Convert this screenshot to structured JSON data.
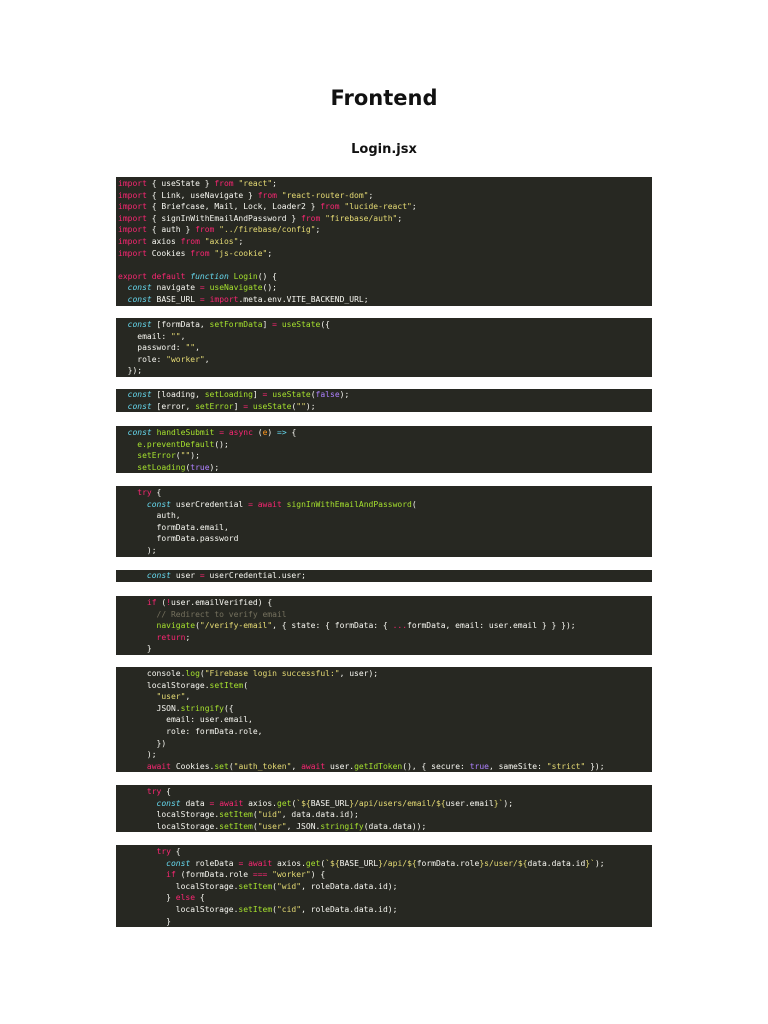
{
  "document": {
    "title": "Frontend",
    "subtitle": "Login.jsx"
  },
  "syntax_colors": {
    "background": "#272822",
    "text": "#f8f8f2",
    "keyword": "#f92672",
    "string": "#e6db74",
    "function": "#a6e22e",
    "storage": "#66d9ef",
    "number_boolean": "#ae81ff",
    "comment": "#75715e",
    "parameter": "#fd971f"
  },
  "code_blocks": [
    {
      "lines": [
        [
          [
            "k",
            "import"
          ],
          [
            "t",
            " { useState } "
          ],
          [
            "k",
            "from"
          ],
          [
            "t",
            " "
          ],
          [
            "s",
            "\"react\""
          ],
          [
            "t",
            ";"
          ]
        ],
        [
          [
            "k",
            "import"
          ],
          [
            "t",
            " { Link, useNavigate } "
          ],
          [
            "k",
            "from"
          ],
          [
            "t",
            " "
          ],
          [
            "s",
            "\"react-router-dom\""
          ],
          [
            "t",
            ";"
          ]
        ],
        [
          [
            "k",
            "import"
          ],
          [
            "t",
            " { Briefcase, Mail, Lock, Loader2 } "
          ],
          [
            "k",
            "from"
          ],
          [
            "t",
            " "
          ],
          [
            "s",
            "\"lucide-react\""
          ],
          [
            "t",
            ";"
          ]
        ],
        [
          [
            "k",
            "import"
          ],
          [
            "t",
            " { signInWithEmailAndPassword } "
          ],
          [
            "k",
            "from"
          ],
          [
            "t",
            " "
          ],
          [
            "s",
            "\"firebase/auth\""
          ],
          [
            "t",
            ";"
          ]
        ],
        [
          [
            "k",
            "import"
          ],
          [
            "t",
            " { auth } "
          ],
          [
            "k",
            "from"
          ],
          [
            "t",
            " "
          ],
          [
            "s",
            "\"../firebase/config\""
          ],
          [
            "t",
            ";"
          ]
        ],
        [
          [
            "k",
            "import"
          ],
          [
            "t",
            " axios "
          ],
          [
            "k",
            "from"
          ],
          [
            "t",
            " "
          ],
          [
            "s",
            "\"axios\""
          ],
          [
            "t",
            ";"
          ]
        ],
        [
          [
            "k",
            "import"
          ],
          [
            "t",
            " Cookies "
          ],
          [
            "k",
            "from"
          ],
          [
            "t",
            " "
          ],
          [
            "s",
            "\"js-cookie\""
          ],
          [
            "t",
            ";"
          ]
        ],
        [
          [
            "t",
            ""
          ]
        ],
        [
          [
            "k",
            "export"
          ],
          [
            "t",
            " "
          ],
          [
            "k",
            "default"
          ],
          [
            "t",
            " "
          ],
          [
            "b",
            "function"
          ],
          [
            "t",
            " "
          ],
          [
            "f",
            "Login"
          ],
          [
            "t",
            "() {"
          ]
        ],
        [
          [
            "t",
            "  "
          ],
          [
            "b",
            "const"
          ],
          [
            "t",
            " navigate "
          ],
          [
            "o",
            "="
          ],
          [
            "t",
            " "
          ],
          [
            "f",
            "useNavigate"
          ],
          [
            "t",
            "();"
          ]
        ],
        [
          [
            "t",
            "  "
          ],
          [
            "b",
            "const"
          ],
          [
            "t",
            " BASE_URL "
          ],
          [
            "o",
            "="
          ],
          [
            "t",
            " "
          ],
          [
            "k",
            "import"
          ],
          [
            "t",
            ".meta.env.VITE_BACKEND_URL;"
          ]
        ]
      ]
    },
    {
      "lines": [
        [
          [
            "t",
            "  "
          ],
          [
            "b",
            "const"
          ],
          [
            "t",
            " [formData, "
          ],
          [
            "f",
            "setFormData"
          ],
          [
            "t",
            "] "
          ],
          [
            "o",
            "="
          ],
          [
            "t",
            " "
          ],
          [
            "f",
            "useState"
          ],
          [
            "t",
            "({"
          ]
        ],
        [
          [
            "t",
            "    email: "
          ],
          [
            "s",
            "\"\""
          ],
          [
            "t",
            ","
          ]
        ],
        [
          [
            "t",
            "    password: "
          ],
          [
            "s",
            "\"\""
          ],
          [
            "t",
            ","
          ]
        ],
        [
          [
            "t",
            "    role: "
          ],
          [
            "s",
            "\"worker\""
          ],
          [
            "t",
            ","
          ]
        ],
        [
          [
            "t",
            "  });"
          ]
        ]
      ]
    },
    {
      "lines": [
        [
          [
            "t",
            "  "
          ],
          [
            "b",
            "const"
          ],
          [
            "t",
            " [loading, "
          ],
          [
            "f",
            "setLoading"
          ],
          [
            "t",
            "] "
          ],
          [
            "o",
            "="
          ],
          [
            "t",
            " "
          ],
          [
            "f",
            "useState"
          ],
          [
            "t",
            "("
          ],
          [
            "n",
            "false"
          ],
          [
            "t",
            ");"
          ]
        ],
        [
          [
            "t",
            "  "
          ],
          [
            "b",
            "const"
          ],
          [
            "t",
            " [error, "
          ],
          [
            "f",
            "setError"
          ],
          [
            "t",
            "] "
          ],
          [
            "o",
            "="
          ],
          [
            "t",
            " "
          ],
          [
            "f",
            "useState"
          ],
          [
            "t",
            "("
          ],
          [
            "s",
            "\"\""
          ],
          [
            "t",
            ");"
          ]
        ]
      ]
    },
    {
      "lines": [
        [
          [
            "t",
            "  "
          ],
          [
            "b",
            "const"
          ],
          [
            "t",
            " "
          ],
          [
            "f",
            "handleSubmit"
          ],
          [
            "t",
            " "
          ],
          [
            "o",
            "="
          ],
          [
            "t",
            " "
          ],
          [
            "k",
            "async"
          ],
          [
            "t",
            " ("
          ],
          [
            "p",
            "e"
          ],
          [
            "t",
            ") "
          ],
          [
            "b",
            "=>"
          ],
          [
            "t",
            " {"
          ]
        ],
        [
          [
            "t",
            "    "
          ],
          [
            "f",
            "e.preventDefault"
          ],
          [
            "t",
            "();"
          ]
        ],
        [
          [
            "t",
            "    "
          ],
          [
            "f",
            "setError"
          ],
          [
            "t",
            "("
          ],
          [
            "s",
            "\"\""
          ],
          [
            "t",
            ");"
          ]
        ],
        [
          [
            "t",
            "    "
          ],
          [
            "f",
            "setLoading"
          ],
          [
            "t",
            "("
          ],
          [
            "n",
            "true"
          ],
          [
            "t",
            ");"
          ]
        ]
      ]
    },
    {
      "lines": [
        [
          [
            "t",
            "    "
          ],
          [
            "k",
            "try"
          ],
          [
            "t",
            " {"
          ]
        ],
        [
          [
            "t",
            "      "
          ],
          [
            "b",
            "const"
          ],
          [
            "t",
            " userCredential "
          ],
          [
            "o",
            "="
          ],
          [
            "t",
            " "
          ],
          [
            "k",
            "await"
          ],
          [
            "t",
            " "
          ],
          [
            "f",
            "signInWithEmailAndPassword"
          ],
          [
            "t",
            "("
          ]
        ],
        [
          [
            "t",
            "        auth,"
          ]
        ],
        [
          [
            "t",
            "        formData.email,"
          ]
        ],
        [
          [
            "t",
            "        formData.password"
          ]
        ],
        [
          [
            "t",
            "      );"
          ]
        ]
      ]
    },
    {
      "lines": [
        [
          [
            "t",
            "      "
          ],
          [
            "b",
            "const"
          ],
          [
            "t",
            " user "
          ],
          [
            "o",
            "="
          ],
          [
            "t",
            " userCredential.user;"
          ]
        ]
      ]
    },
    {
      "lines": [
        [
          [
            "t",
            "      "
          ],
          [
            "k",
            "if"
          ],
          [
            "t",
            " ("
          ],
          [
            "o",
            "!"
          ],
          [
            "t",
            "user.emailVerified) {"
          ]
        ],
        [
          [
            "t",
            "        "
          ],
          [
            "c",
            "// Redirect to verify email"
          ]
        ],
        [
          [
            "t",
            "        "
          ],
          [
            "f",
            "navigate"
          ],
          [
            "t",
            "("
          ],
          [
            "s",
            "\"/verify-email\""
          ],
          [
            "t",
            ", { state: { formData: { "
          ],
          [
            "o",
            "..."
          ],
          [
            "t",
            "formData, email: user.email } } });"
          ]
        ],
        [
          [
            "t",
            "        "
          ],
          [
            "k",
            "return"
          ],
          [
            "t",
            ";"
          ]
        ],
        [
          [
            "t",
            "      }"
          ]
        ]
      ]
    },
    {
      "lines": [
        [
          [
            "t",
            "      console."
          ],
          [
            "f",
            "log"
          ],
          [
            "t",
            "("
          ],
          [
            "s",
            "\"Firebase login successful:\""
          ],
          [
            "t",
            ", user);"
          ]
        ],
        [
          [
            "t",
            "      localStorage."
          ],
          [
            "f",
            "setItem"
          ],
          [
            "t",
            "("
          ]
        ],
        [
          [
            "t",
            "        "
          ],
          [
            "s",
            "\"user\""
          ],
          [
            "t",
            ","
          ]
        ],
        [
          [
            "t",
            "        JSON."
          ],
          [
            "f",
            "stringify"
          ],
          [
            "t",
            "({"
          ]
        ],
        [
          [
            "t",
            "          email: user.email,"
          ]
        ],
        [
          [
            "t",
            "          role: formData.role,"
          ]
        ],
        [
          [
            "t",
            "        })"
          ]
        ],
        [
          [
            "t",
            "      );"
          ]
        ],
        [
          [
            "t",
            "      "
          ],
          [
            "k",
            "await"
          ],
          [
            "t",
            " Cookies."
          ],
          [
            "f",
            "set"
          ],
          [
            "t",
            "("
          ],
          [
            "s",
            "\"auth_token\""
          ],
          [
            "t",
            ", "
          ],
          [
            "k",
            "await"
          ],
          [
            "t",
            " user."
          ],
          [
            "f",
            "getIdToken"
          ],
          [
            "t",
            "(), { secure: "
          ],
          [
            "n",
            "true"
          ],
          [
            "t",
            ", sameSite: "
          ],
          [
            "s",
            "\"strict\""
          ],
          [
            "t",
            " });"
          ]
        ]
      ]
    },
    {
      "lines": [
        [
          [
            "t",
            "      "
          ],
          [
            "k",
            "try"
          ],
          [
            "t",
            " {"
          ]
        ],
        [
          [
            "t",
            "        "
          ],
          [
            "b",
            "const"
          ],
          [
            "t",
            " data "
          ],
          [
            "o",
            "="
          ],
          [
            "t",
            " "
          ],
          [
            "k",
            "await"
          ],
          [
            "t",
            " axios."
          ],
          [
            "f",
            "get"
          ],
          [
            "t",
            "("
          ],
          [
            "s",
            "`${"
          ],
          [
            "t",
            "BASE_URL"
          ],
          [
            "s",
            "}/api/users/email/${"
          ],
          [
            "t",
            "user.email"
          ],
          [
            "s",
            "}`"
          ],
          [
            "t",
            ");"
          ]
        ],
        [
          [
            "t",
            "        localStorage."
          ],
          [
            "f",
            "setItem"
          ],
          [
            "t",
            "("
          ],
          [
            "s",
            "\"uid\""
          ],
          [
            "t",
            ", data.data.id);"
          ]
        ],
        [
          [
            "t",
            "        localStorage."
          ],
          [
            "f",
            "setItem"
          ],
          [
            "t",
            "("
          ],
          [
            "s",
            "\"user\""
          ],
          [
            "t",
            ", JSON."
          ],
          [
            "f",
            "stringify"
          ],
          [
            "t",
            "(data.data));"
          ]
        ]
      ]
    },
    {
      "lines": [
        [
          [
            "t",
            "        "
          ],
          [
            "k",
            "try"
          ],
          [
            "t",
            " {"
          ]
        ],
        [
          [
            "t",
            "          "
          ],
          [
            "b",
            "const"
          ],
          [
            "t",
            " roleData "
          ],
          [
            "o",
            "="
          ],
          [
            "t",
            " "
          ],
          [
            "k",
            "await"
          ],
          [
            "t",
            " axios."
          ],
          [
            "f",
            "get"
          ],
          [
            "t",
            "("
          ],
          [
            "s",
            "`${"
          ],
          [
            "t",
            "BASE_URL"
          ],
          [
            "s",
            "}/api/${"
          ],
          [
            "t",
            "formData.role"
          ],
          [
            "s",
            "}s/user/${"
          ],
          [
            "t",
            "data.data.id"
          ],
          [
            "s",
            "}`"
          ],
          [
            "t",
            ");"
          ]
        ],
        [
          [
            "t",
            "          "
          ],
          [
            "k",
            "if"
          ],
          [
            "t",
            " (formData.role "
          ],
          [
            "o",
            "==="
          ],
          [
            "t",
            " "
          ],
          [
            "s",
            "\"worker\""
          ],
          [
            "t",
            ") {"
          ]
        ],
        [
          [
            "t",
            "            localStorage."
          ],
          [
            "f",
            "setItem"
          ],
          [
            "t",
            "("
          ],
          [
            "s",
            "\"wid\""
          ],
          [
            "t",
            ", roleData.data.id);"
          ]
        ],
        [
          [
            "t",
            "          } "
          ],
          [
            "k",
            "else"
          ],
          [
            "t",
            " {"
          ]
        ],
        [
          [
            "t",
            "            localStorage."
          ],
          [
            "f",
            "setItem"
          ],
          [
            "t",
            "("
          ],
          [
            "s",
            "\"cid\""
          ],
          [
            "t",
            ", roleData.data.id);"
          ]
        ],
        [
          [
            "t",
            "          }"
          ]
        ]
      ]
    }
  ]
}
